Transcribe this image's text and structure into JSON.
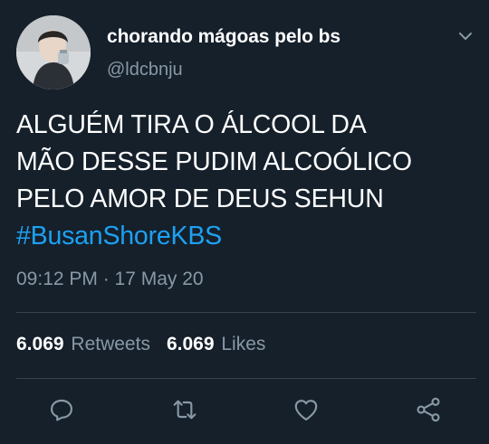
{
  "tweet": {
    "display_name": "chorando mágoas pelo bs",
    "handle": "@ldcbnju",
    "text": "ALGUÉM TIRA O ÁLCOOL DA\nMÃO DESSE PUDIM ALCOÓLICO\nPELO AMOR DE DEUS SEHUN",
    "hashtag": "#BusanShoreKBS",
    "timestamp": "09:12 PM · 17 May 20"
  },
  "stats": {
    "retweets_count": "6.069",
    "retweets_label": "Retweets",
    "likes_count": "6.069",
    "likes_label": "Likes"
  },
  "actions": {
    "icons": [
      "reply-icon",
      "retweet-icon",
      "like-icon",
      "share-icon"
    ]
  },
  "colors": {
    "background": "#15202b",
    "text_primary": "#ffffff",
    "text_secondary": "#8899a6",
    "link": "#1da1f2",
    "divider": "#38444d"
  }
}
